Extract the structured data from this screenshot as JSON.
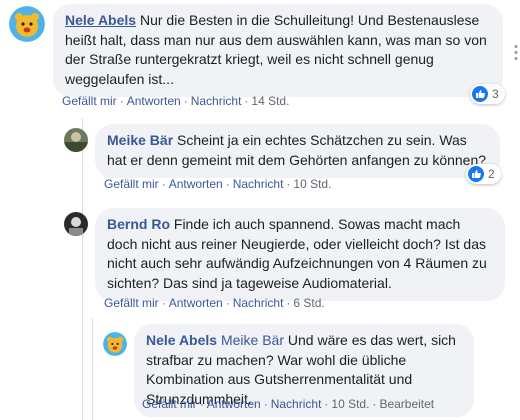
{
  "comments": [
    {
      "author": "Nele Abels",
      "text": "Nur die Besten in die Schulleitung! Und Bestenauslese heißt halt, dass man nur aus dem auswählen kann, was man so von der Straße runtergekratzt kriegt, weil es nicht schnell genug weggelaufen ist...",
      "actions": [
        "Gefällt mir",
        "Antworten",
        "Nachricht"
      ],
      "time": "14 Std.",
      "reactions": "3"
    },
    {
      "author": "Meike Bär",
      "text": "Scheint ja ein echtes Schätzchen zu sein. Was hat er denn gemeint mit dem Gehörten anfangen zu können?",
      "actions": [
        "Gefällt mir",
        "Antworten",
        "Nachricht"
      ],
      "time": "10 Std.",
      "reactions": "2"
    },
    {
      "author": "Bernd Ro",
      "text": "Finde ich auch spannend. Sowas macht mach doch nicht aus reiner Neugierde, oder vielleicht doch? Ist das nicht auch sehr aufwändig Aufzeichnungen von 4 Räumen zu sichten? Das sind ja tageweise Audiomaterial.",
      "actions": [
        "Gefällt mir",
        "Antworten",
        "Nachricht"
      ],
      "time": "6 Std."
    },
    {
      "author": "Nele Abels",
      "mention": "Meike Bär",
      "text": "Und wäre es das wert, sich strafbar zu machen? War wohl die übliche Kombination aus Gutsherrenmentalität und Strunzdummheit.",
      "actions": [
        "Gefällt mir",
        "Antworten",
        "Nachricht"
      ],
      "time": "10 Std.",
      "edited": "Bearbeitet"
    }
  ],
  "colors": {
    "link": "#385898",
    "bubble": "#f0f2f5",
    "meta": "#606770",
    "like": "#1877f2"
  }
}
